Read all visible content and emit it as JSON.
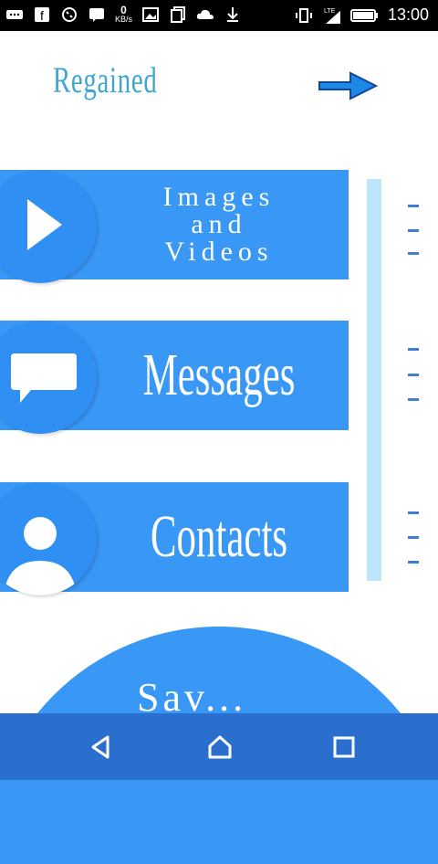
{
  "status_bar": {
    "kbps_value": "0",
    "kbps_unit": "KB/s",
    "lte": "LTE",
    "time": "13:00"
  },
  "header": {
    "title": "Regained"
  },
  "cards": [
    {
      "label_lines": [
        "Images",
        "and",
        "Videos"
      ],
      "icon": "play-icon"
    },
    {
      "label": "Messages",
      "icon": "message-icon"
    },
    {
      "label": "Contacts",
      "icon": "person-icon"
    }
  ],
  "save": {
    "label": "Sav..."
  },
  "nav": {
    "back": "back-icon",
    "home": "home-icon",
    "recents": "recents-icon"
  }
}
